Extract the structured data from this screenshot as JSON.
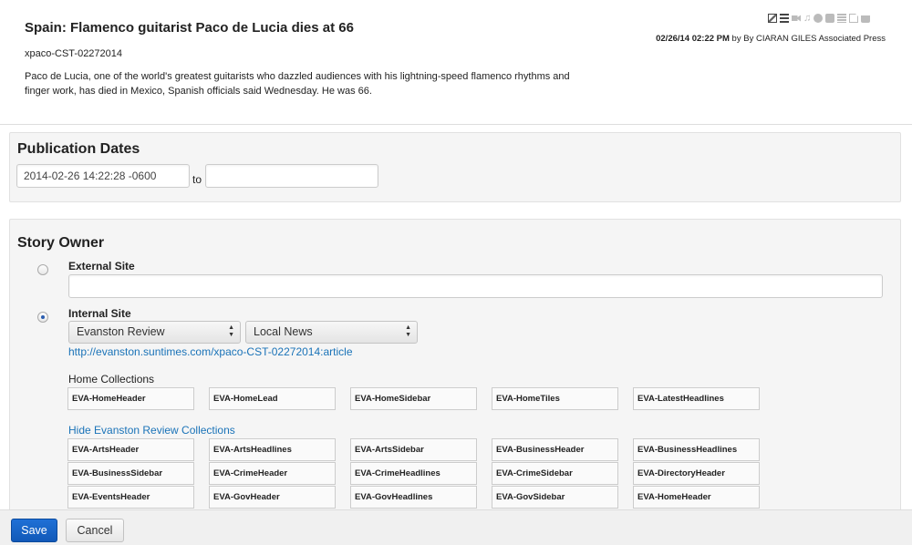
{
  "story": {
    "title": "Spain: Flamenco guitarist Paco de Lucia dies at 66",
    "slug": "xpaco-CST-02272014",
    "summary": "Paco de Lucia, one of the world's greatest guitarists who dazzled audiences with his lightning-speed flamenco rhythms and finger work, has died in Mexico, Spanish officials said Wednesday. He was 66.",
    "timestamp": "02/26/14 02:22 PM",
    "byline": " by By CIARAN GILES Associated Press",
    "media_icons": [
      "image-icon",
      "list-icon",
      "video-icon",
      "audio-icon",
      "globe-icon",
      "gallery-icon",
      "text-icon",
      "document-icon",
      "briefcase-icon"
    ]
  },
  "publication": {
    "heading": "Publication Dates",
    "from_value": "2014-02-26 14:22:28 -0600",
    "to_label": "to",
    "to_value": ""
  },
  "owner": {
    "heading": "Story Owner",
    "external_label": "External Site",
    "external_value": "",
    "internal_label": "Internal Site",
    "site_select": "Evanston Review",
    "section_select": "Local News",
    "article_link": "http://evanston.suntimes.com/xpaco-CST-02272014:article",
    "home_collections_label": "Home Collections",
    "home_collections": [
      "EVA-HomeHeader",
      "EVA-HomeLead",
      "EVA-HomeSidebar",
      "EVA-HomeTiles",
      "EVA-LatestHeadlines"
    ],
    "hide_link": "Hide Evanston Review Collections",
    "collections": [
      [
        "EVA-ArtsHeader",
        "EVA-ArtsHeadlines",
        "EVA-ArtsSidebar",
        "EVA-BusinessHeader",
        "EVA-BusinessHeadlines"
      ],
      [
        "EVA-BusinessSidebar",
        "EVA-CrimeHeader",
        "EVA-CrimeHeadlines",
        "EVA-CrimeSidebar",
        "EVA-DirectoryHeader"
      ],
      [
        "EVA-EventsHeader",
        "EVA-GovHeader",
        "EVA-GovHeadlines",
        "EVA-GovSidebar",
        "EVA-HomeHeader"
      ]
    ]
  },
  "footer": {
    "save_label": "Save",
    "cancel_label": "Cancel"
  },
  "colors": {
    "primary_button": "#1f70d6",
    "link": "#1a73b8",
    "panel_bg": "#f5f5f5"
  }
}
